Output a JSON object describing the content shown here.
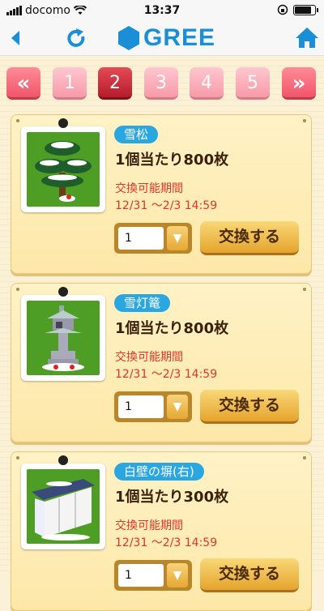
{
  "status_bar": {
    "carrier": "docomo",
    "time": "13:37"
  },
  "nav": {
    "brand": "GREE"
  },
  "pager": {
    "prev_label": "«",
    "next_label": "»",
    "pages": [
      "1",
      "2",
      "3",
      "4",
      "5"
    ],
    "current": "2"
  },
  "items": [
    {
      "name": "雪松",
      "price": "1個当たり800枚",
      "period_label": "交換可能期間",
      "period": "12/31 〜2/3 14:59",
      "quantity": "1",
      "button": "交換する"
    },
    {
      "name": "雪灯篭",
      "price": "1個当たり800枚",
      "period_label": "交換可能期間",
      "period": "12/31 〜2/3 14:59",
      "quantity": "1",
      "button": "交換する"
    },
    {
      "name": "白壁の塀(右)",
      "price": "1個当たり300枚",
      "period_label": "交換可能期間",
      "period": "12/31 〜2/3 14:59",
      "quantity": "1",
      "button": "交換する"
    }
  ],
  "colors": {
    "accent": "#1a8fd8",
    "badge": "#2aa7e0",
    "period_text": "#e0342a",
    "page_current": "#c52533",
    "page_normal": "#f7a3b0"
  }
}
